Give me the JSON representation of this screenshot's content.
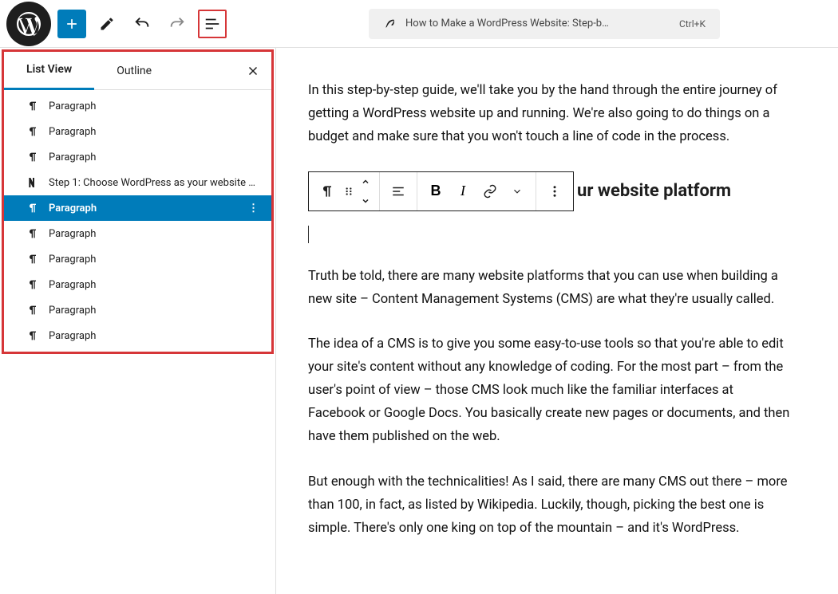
{
  "topbar": {
    "title": "How to Make a WordPress Website: Step-b…",
    "shortcut": "Ctrl+K"
  },
  "sidebar": {
    "tabs": {
      "listview": "List View",
      "outline": "Outline"
    },
    "items": [
      {
        "label": "Paragraph",
        "icon": "paragraph"
      },
      {
        "label": "Paragraph",
        "icon": "paragraph"
      },
      {
        "label": "Paragraph",
        "icon": "paragraph"
      },
      {
        "label": "Step 1: Choose WordPress as your website …",
        "icon": "heading"
      },
      {
        "label": "Paragraph",
        "icon": "paragraph",
        "selected": true
      },
      {
        "label": "Paragraph",
        "icon": "paragraph"
      },
      {
        "label": "Paragraph",
        "icon": "paragraph"
      },
      {
        "label": "Paragraph",
        "icon": "paragraph"
      },
      {
        "label": "Paragraph",
        "icon": "paragraph"
      },
      {
        "label": "Paragraph",
        "icon": "paragraph"
      }
    ]
  },
  "content": {
    "p1": "In this step-by-step guide, we'll take you by the hand through the entire journey of getting a WordPress website up and running. We're also going to do things on a budget and make sure that you won't touch a line of code in the process.",
    "heading_fragment": "ur website platform",
    "p2": "Truth be told, there are many website platforms that you can use when building a new site – Content Management Systems (CMS) are what they're usually called.",
    "p3": "The idea of a CMS is to give you some easy-to-use tools so that you're able to edit your site's content without any knowledge of coding. For the most part – from the user's point of view – those CMS look much like the familiar interfaces at Facebook or Google Docs. You basically create new pages or documents, and then have them published on the web.",
    "p4": "But enough with the technicalities! As I said, there are many CMS out there – more than 100, in fact, as listed by Wikipedia. Luckily, though, picking the best one is simple. There's only one king on top of the mountain – and it's WordPress."
  },
  "toolbar_labels": {
    "bold": "B",
    "italic": "I"
  }
}
